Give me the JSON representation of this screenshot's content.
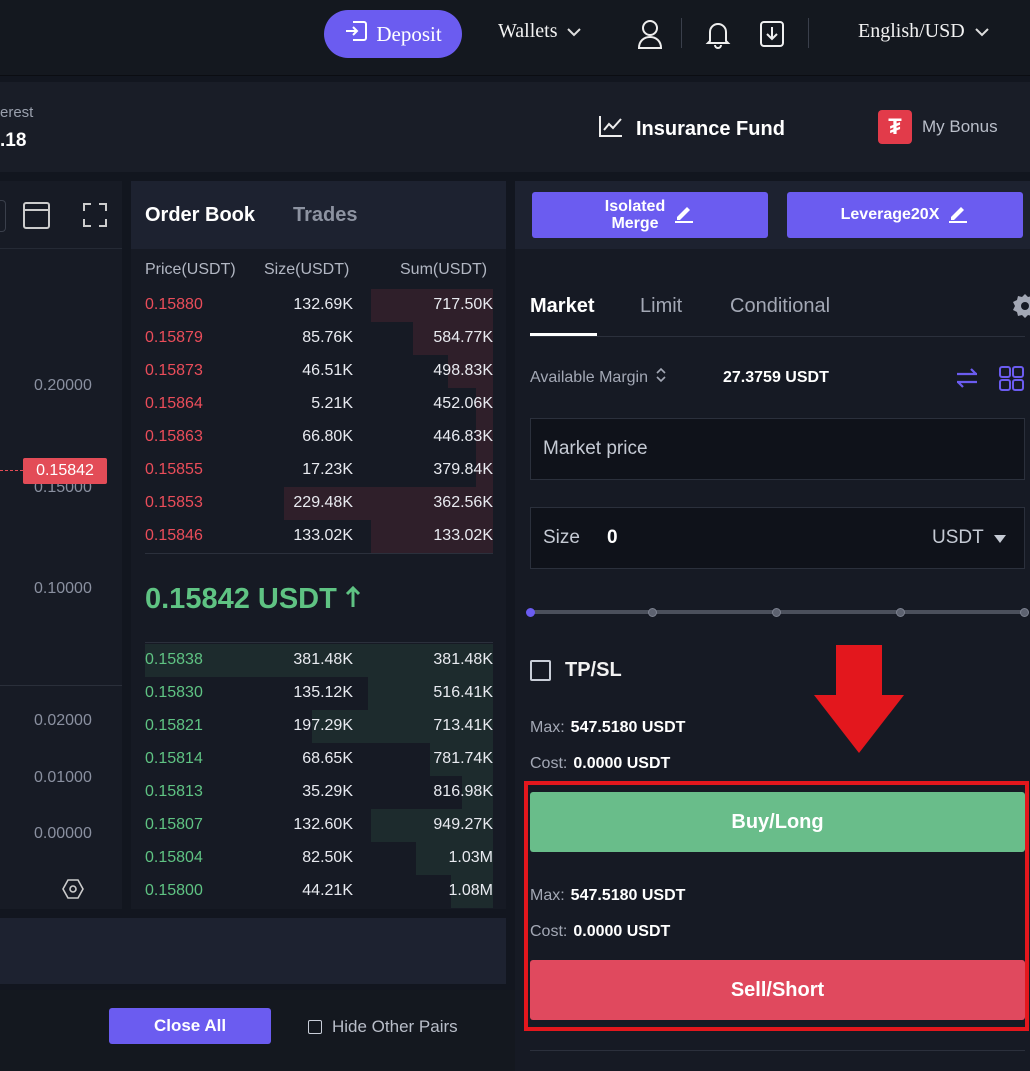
{
  "nav": {
    "deposit_label": "Deposit",
    "wallets_label": "Wallets",
    "language_label": "English/USD"
  },
  "subbar": {
    "interest_label": "erest",
    "interest_value": ".18",
    "insurance_fund_label": "Insurance Fund",
    "my_bonus_label": "My Bonus",
    "bonus_icon": "tether-icon"
  },
  "chart": {
    "axis_labels": [
      "0.20000",
      "0.15000",
      "0.10000",
      "0.02000",
      "0.01000",
      "0.00000"
    ],
    "current_price_tag": "0.15842"
  },
  "orderbook": {
    "tab_orderbook": "Order Book",
    "tab_trades": "Trades",
    "col_price": "Price(USDT)",
    "col_size": "Size(USDT)",
    "col_sum": "Sum(USDT)",
    "asks": [
      {
        "price": "0.15880",
        "size": "132.69K",
        "sum": "717.50K",
        "depth": 0.35
      },
      {
        "price": "0.15879",
        "size": "85.76K",
        "sum": "584.77K",
        "depth": 0.23
      },
      {
        "price": "0.15873",
        "size": "46.51K",
        "sum": "498.83K",
        "depth": 0.13
      },
      {
        "price": "0.15864",
        "size": "5.21K",
        "sum": "452.06K",
        "depth": 0.05
      },
      {
        "price": "0.15863",
        "size": "66.80K",
        "sum": "446.83K",
        "depth": 0.05
      },
      {
        "price": "0.15855",
        "size": "17.23K",
        "sum": "379.84K",
        "depth": 0.05
      },
      {
        "price": "0.15853",
        "size": "229.48K",
        "sum": "362.56K",
        "depth": 0.6
      },
      {
        "price": "0.15846",
        "size": "133.02K",
        "sum": "133.02K",
        "depth": 0.35
      }
    ],
    "mid_price": "0.15842 USDT",
    "bids": [
      {
        "price": "0.15838",
        "size": "381.48K",
        "sum": "381.48K",
        "depth": 1.0
      },
      {
        "price": "0.15830",
        "size": "135.12K",
        "sum": "516.41K",
        "depth": 0.36
      },
      {
        "price": "0.15821",
        "size": "197.29K",
        "sum": "713.41K",
        "depth": 0.52
      },
      {
        "price": "0.15814",
        "size": "68.65K",
        "sum": "781.74K",
        "depth": 0.18
      },
      {
        "price": "0.15813",
        "size": "35.29K",
        "sum": "816.98K",
        "depth": 0.09
      },
      {
        "price": "0.15807",
        "size": "132.60K",
        "sum": "949.27K",
        "depth": 0.35
      },
      {
        "price": "0.15804",
        "size": "82.50K",
        "sum": "1.03M",
        "depth": 0.22
      },
      {
        "price": "0.15800",
        "size": "44.21K",
        "sum": "1.08M",
        "depth": 0.12
      }
    ]
  },
  "bottom": {
    "close_all_label": "Close All",
    "hide_pairs_label": "Hide Other Pairs"
  },
  "trade": {
    "isolated_label_1": "Isolated",
    "isolated_label_2": "Merge",
    "leverage_label": "Leverage20X",
    "tabs": [
      "Market",
      "Limit",
      "Conditional"
    ],
    "available_margin_label": "Available Margin",
    "available_margin_value": "27.3759 USDT",
    "market_price_placeholder": "Market price",
    "size_label": "Size",
    "size_value": "0",
    "size_unit": "USDT",
    "slider_level": 0,
    "tpsl_label": "TP/SL",
    "buy_max_label": "Max:",
    "buy_max_value": "547.5180 USDT",
    "buy_cost_label": "Cost:",
    "buy_cost_value": "0.0000 USDT",
    "buy_label": "Buy/Long",
    "sell_max_label": "Max:",
    "sell_max_value": "547.5180 USDT",
    "sell_cost_label": "Cost:",
    "sell_cost_value": "0.0000 USDT",
    "sell_label": "Sell/Short"
  },
  "colors": {
    "accent": "#6b5cf0",
    "ask": "#ea4d5a",
    "bid": "#5fc383",
    "buy": "#69bd8a",
    "sell": "#e0495e",
    "highlight": "#e3171d"
  }
}
